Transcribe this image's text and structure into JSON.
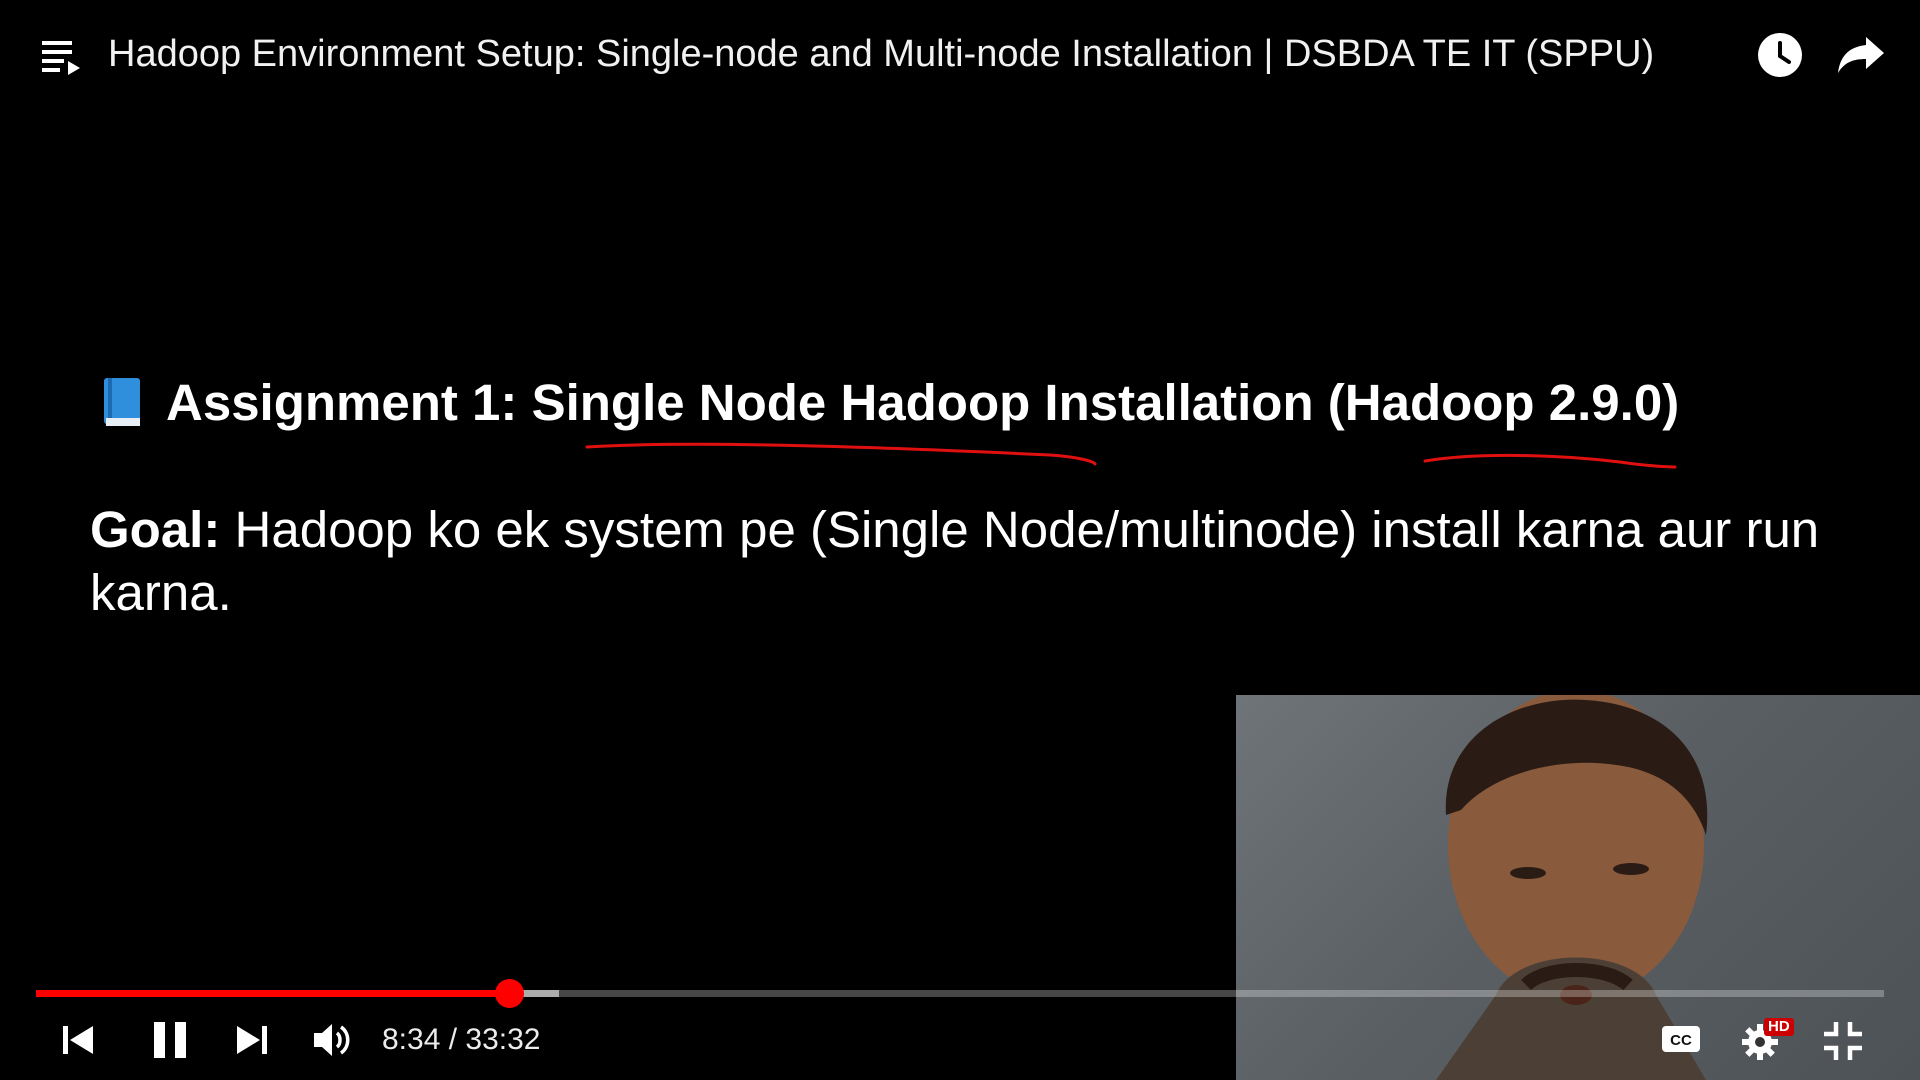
{
  "player": {
    "title": "Hadoop Environment Setup: Single-node and Multi-node Installation | DSBDA TE IT (SPPU)",
    "current_time": "8:34",
    "duration": "33:32",
    "time_separator": " / ",
    "progress_fraction": 0.256,
    "buffered_fraction": 0.283,
    "hd_label": "HD",
    "accent_color": "#ff0000"
  },
  "slide": {
    "heading_prefix": "Assignment 1: ",
    "heading_underlined_1": "Single Node Hadoop Installation",
    "heading_middle": " (",
    "heading_underlined_2": "Hadoop 2.9.0",
    "heading_suffix": ")",
    "goal_label": "Goal:",
    "goal_text": " Hadoop ko ek system pe (Single Node/multinode) install karna aur run karna.",
    "annotation_color": "#e01010"
  },
  "icons": {
    "playlist": "playlist-icon",
    "watch_later": "clock-icon",
    "share": "share-arrow-icon",
    "book": "blue-book-icon",
    "prev": "skip-previous-icon",
    "pause": "pause-icon",
    "next": "skip-next-icon",
    "volume": "volume-icon",
    "cc": "closed-captions-icon",
    "settings": "gear-icon",
    "fullscreen_exit": "exit-fullscreen-icon"
  }
}
